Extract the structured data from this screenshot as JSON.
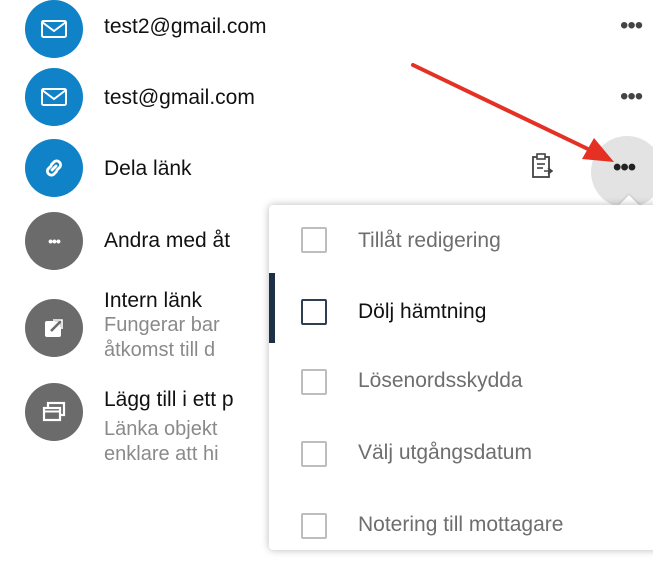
{
  "share_list": {
    "items": [
      {
        "label": "test2@gmail.com",
        "icon": "mail-icon",
        "color": "#0f82c8"
      },
      {
        "label": "test@gmail.com",
        "icon": "mail-icon",
        "color": "#0f82c8"
      },
      {
        "label": "Dela länk",
        "icon": "link-icon",
        "color": "#0f82c8"
      },
      {
        "label": "Andra med åt",
        "icon": "ellipsis-icon",
        "color": "#6b6b6b"
      },
      {
        "label": "Intern länk",
        "sub1": "Fungerar bar",
        "sub2": "åtkomst till d",
        "icon": "external-link-icon",
        "color": "#6b6b6b"
      },
      {
        "label": "Lägg till i ett p",
        "sub1": "Länka objekt",
        "sub2": "enklare att hi",
        "icon": "windows-icon",
        "color": "#6b6b6b"
      }
    ],
    "more_glyph": "•••"
  },
  "menu": {
    "items": [
      {
        "label": "Tillåt redigering",
        "checked": false
      },
      {
        "label": "Dölj hämtning",
        "checked": false,
        "active": true
      },
      {
        "label": "Lösenordsskydda",
        "checked": false
      },
      {
        "label": "Välj utgångsdatum",
        "checked": false
      },
      {
        "label": "Notering till mottagare",
        "checked": false
      }
    ]
  },
  "colors": {
    "accent": "#0f82c8",
    "annotation_arrow": "#e53024",
    "active_indicator": "#1c3147"
  }
}
